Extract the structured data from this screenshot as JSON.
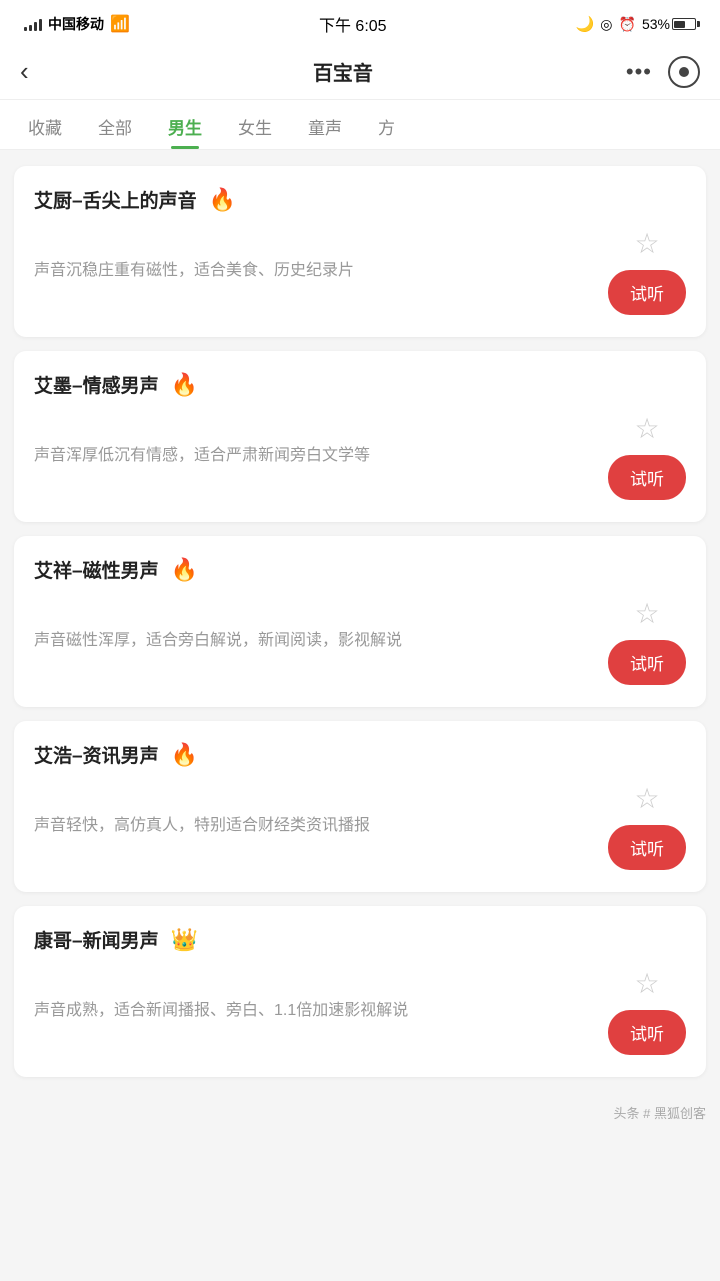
{
  "statusBar": {
    "carrier": "中国移动",
    "time": "下午 6:05",
    "battery": "53%"
  },
  "navBar": {
    "title": "百宝音",
    "backLabel": "‹",
    "moreLabel": "•••"
  },
  "tabs": [
    {
      "id": "collect",
      "label": "收藏",
      "active": false
    },
    {
      "id": "all",
      "label": "全部",
      "active": false
    },
    {
      "id": "male",
      "label": "男生",
      "active": true
    },
    {
      "id": "female",
      "label": "女生",
      "active": false
    },
    {
      "id": "child",
      "label": "童声",
      "active": false
    },
    {
      "id": "fang",
      "label": "方",
      "active": false
    }
  ],
  "voices": [
    {
      "id": "v1",
      "title": "艾厨–舌尖上的声音",
      "iconType": "fire",
      "desc": "声音沉稳庄重有磁性，适合美食、历史纪录片",
      "tryLabel": "试听"
    },
    {
      "id": "v2",
      "title": "艾墨–情感男声",
      "iconType": "fire",
      "desc": "声音浑厚低沉有情感，适合严肃新闻旁白文学等",
      "tryLabel": "试听"
    },
    {
      "id": "v3",
      "title": "艾祥–磁性男声",
      "iconType": "fire",
      "desc": "声音磁性浑厚，适合旁白解说，新闻阅读，影视解说",
      "tryLabel": "试听"
    },
    {
      "id": "v4",
      "title": "艾浩–资讯男声",
      "iconType": "fire",
      "desc": "声音轻快，高仿真人，特别适合财经类资讯播报",
      "tryLabel": "试听"
    },
    {
      "id": "v5",
      "title": "康哥–新闻男声",
      "iconType": "crown",
      "desc": "声音成熟，适合新闻播报、旁白、1.1倍加速影视解说",
      "tryLabel": "试听"
    }
  ],
  "watermark": {
    "prefix": "头条",
    "brand": "# 黑狐创客"
  }
}
